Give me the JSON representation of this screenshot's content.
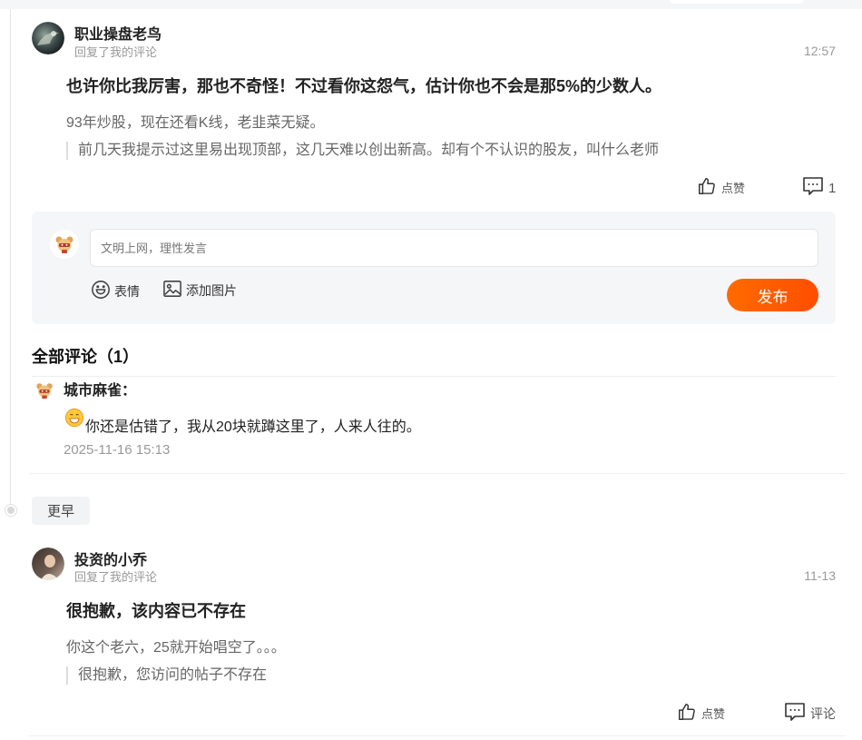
{
  "notifications": [
    {
      "author": "职业操盘老鸟",
      "action": "回复了我的评论",
      "time": "12:57",
      "title": "也许你比我厉害，那也不奇怪！不过看你这怨气，估计你也不会是那5%的少数人。",
      "content": "93年炒股，现在还看K线，老韭菜无疑。",
      "quote": "前几天我提示过这里易出现顶部，这几天难以创出新高。却有个不认识的股友，叫什么老师",
      "like_label": "点赞",
      "comment_label": "1"
    },
    {
      "author": "投资的小乔",
      "action": "回复了我的评论",
      "time": "11-13",
      "title": "很抱歉，该内容已不存在",
      "content": "你这个老六，25就开始唱空了。。。",
      "quote": "很抱歉，您访问的帖子不存在",
      "like_label": "点赞",
      "comment_label": "评论"
    }
  ],
  "reply_box": {
    "placeholder": "文明上网，理性发言",
    "emoji_label": "表情",
    "image_label": "添加图片",
    "submit_label": "发布"
  },
  "comments_section": {
    "title": "全部评论（1）",
    "comments": [
      {
        "author": "城市麻雀：",
        "text": "你还是估错了，我从20块就蹲这里了，人来人往的。",
        "time": "2025-11-16 15:13"
      }
    ]
  },
  "earlier_label": "更早",
  "icons": {
    "like": "thumbs-up-icon",
    "comment": "comment-bubble-icon",
    "emoji": "smiley-icon",
    "image": "image-icon"
  },
  "colors": {
    "accent": "#ff5a00",
    "muted_text": "#999999",
    "panel_bg": "#f5f6f8"
  }
}
